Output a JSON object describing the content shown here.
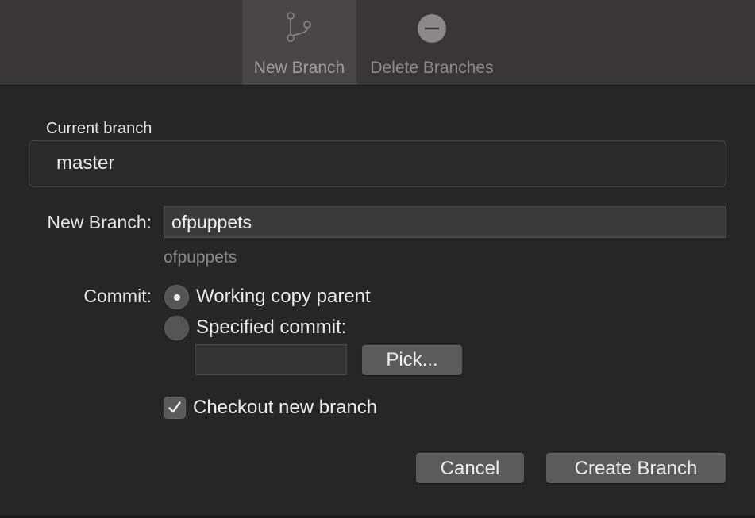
{
  "toolbar": {
    "new_branch_label": "New Branch",
    "delete_branches_label": "Delete Branches",
    "new_branch_icon": "branch-icon",
    "delete_branches_icon": "minus-circle-icon"
  },
  "current_branch": {
    "title": "Current branch",
    "value": "master"
  },
  "form": {
    "new_branch_label": "New Branch:",
    "new_branch_value": "ofpuppets",
    "new_branch_hint": "ofpuppets",
    "commit_label": "Commit:",
    "commit_options": [
      {
        "label": "Working copy parent",
        "selected": true
      },
      {
        "label": "Specified commit:",
        "selected": false
      }
    ],
    "specified_commit_value": "",
    "pick_label": "Pick...",
    "checkout_label": "Checkout new branch",
    "checkout_checked": true
  },
  "buttons": {
    "cancel": "Cancel",
    "create": "Create Branch"
  }
}
